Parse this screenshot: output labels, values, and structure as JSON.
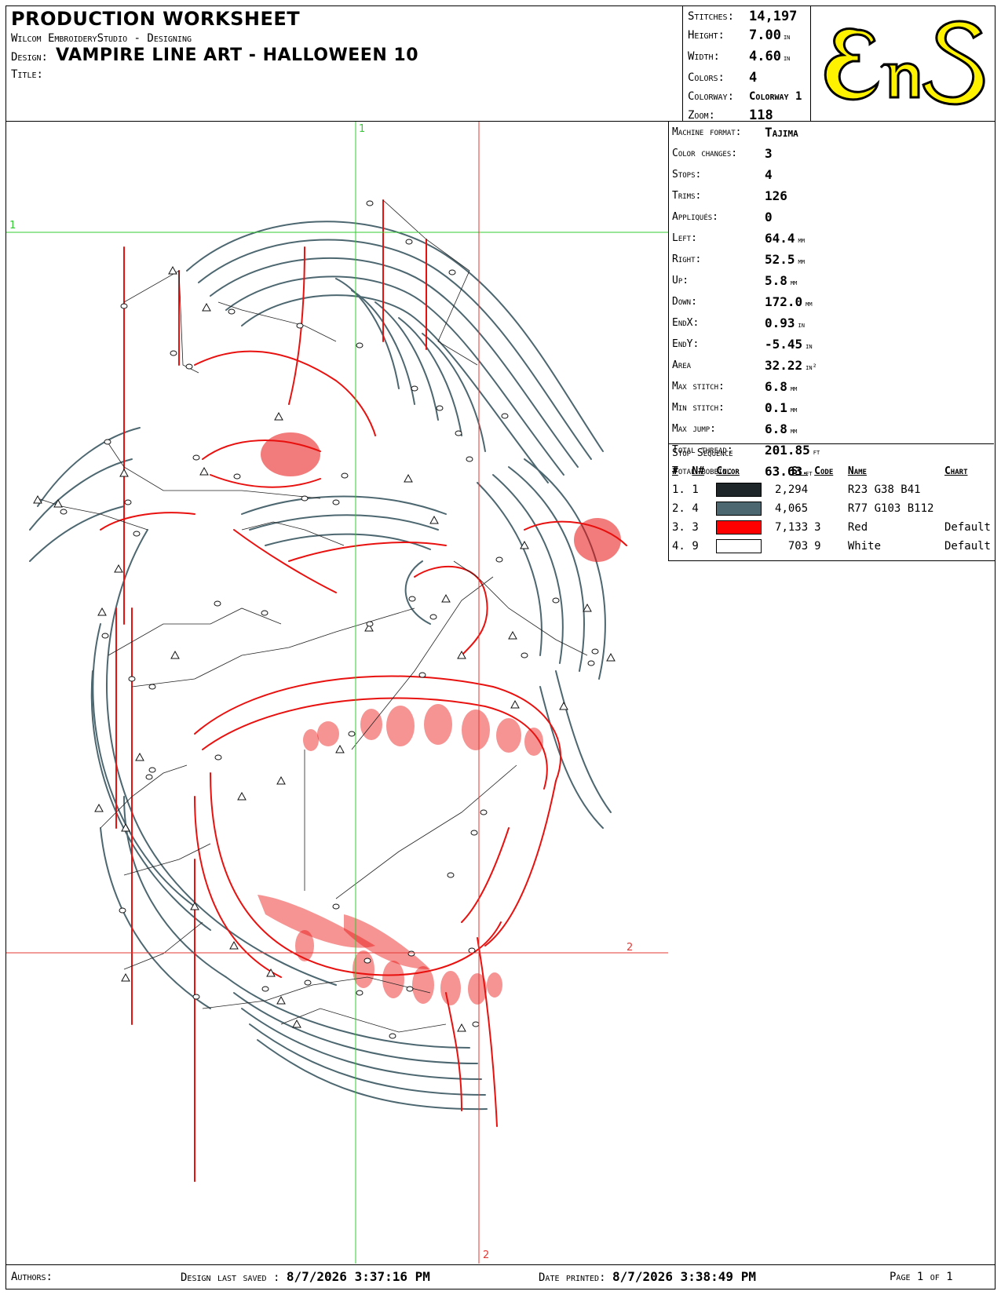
{
  "header": {
    "title": "PRODUCTION WORKSHEET",
    "software": "Wilcom EmbroideryStudio - Designing",
    "design_label": "Design:",
    "design_value": "VAMPIRE LINE ART - HALLOWEEN  10",
    "title_label": "Title:"
  },
  "summary": [
    {
      "label": "Stitches:",
      "value": "14,197",
      "unit": ""
    },
    {
      "label": "Height:",
      "value": "7.00",
      "unit": "in"
    },
    {
      "label": "Width:",
      "value": "4.60",
      "unit": "in"
    },
    {
      "label": "Colors:",
      "value": "4",
      "unit": ""
    },
    {
      "label": "Colorway:",
      "value": "Colorway 1",
      "unit": ""
    },
    {
      "label": "Zoom:",
      "value": "118",
      "unit": ""
    }
  ],
  "logo": {
    "text": "EnS",
    "fill_color": "#FFF200",
    "stroke_color": "#000000"
  },
  "stats": [
    {
      "label": "Machine format:",
      "value": "Tajima",
      "unit": ""
    },
    {
      "label": "Color changes:",
      "value": "3",
      "unit": ""
    },
    {
      "label": "Stops:",
      "value": "4",
      "unit": ""
    },
    {
      "label": "Trims:",
      "value": "126",
      "unit": ""
    },
    {
      "label": "Appliqués:",
      "value": "0",
      "unit": ""
    },
    {
      "label": "Left:",
      "value": "64.4",
      "unit": "mm"
    },
    {
      "label": "Right:",
      "value": "52.5",
      "unit": "mm"
    },
    {
      "label": "Up:",
      "value": "5.8",
      "unit": "mm"
    },
    {
      "label": "Down:",
      "value": "172.0",
      "unit": "mm"
    },
    {
      "label": "EndX:",
      "value": "0.93",
      "unit": "in"
    },
    {
      "label": "EndY:",
      "value": "-5.45",
      "unit": "in"
    },
    {
      "label": "Area",
      "value": "32.22",
      "unit": "in²"
    },
    {
      "label": "Max stitch:",
      "value": "6.8",
      "unit": "mm"
    },
    {
      "label": "Min stitch:",
      "value": "0.1",
      "unit": "mm"
    },
    {
      "label": "Max jump:",
      "value": "6.8",
      "unit": "mm"
    },
    {
      "label": "Total thread:",
      "value": "201.85",
      "unit": "ft"
    },
    {
      "label": "Total bobbin:",
      "value": "63.63",
      "unit": "ft"
    }
  ],
  "stop_sequence": {
    "caption": "Stop Sequence",
    "headers": [
      "#",
      "N#",
      "Color",
      "St.",
      "Code",
      "Name",
      "Chart"
    ],
    "rows": [
      {
        "n": "1.",
        "needle": "1",
        "color": "#1E2629",
        "stitches": "2,294",
        "code": "",
        "name": "R23 G38 B41",
        "chart": ""
      },
      {
        "n": "2.",
        "needle": "4",
        "color": "#4D6770",
        "stitches": "4,065",
        "code": "",
        "name": "R77 G103 B112",
        "chart": ""
      },
      {
        "n": "3.",
        "needle": "3",
        "color": "#FF0000",
        "stitches": "7,133",
        "code": "3",
        "name": "Red",
        "chart": "Default"
      },
      {
        "n": "4.",
        "needle": "9",
        "color": "#FFFFFF",
        "stitches": "703",
        "code": "9",
        "name": "White",
        "chart": "Default"
      }
    ]
  },
  "guides": {
    "v1_label": "1",
    "h1_label": "1",
    "v2_label": "2",
    "h2_label": "2",
    "green": "#33CC33",
    "red": "#E53935"
  },
  "artwork": {
    "thread_dark": "#4D6770",
    "thread_red": "#E8110F"
  },
  "footer": {
    "authors_label": "Authors:",
    "saved_label": "Design last saved :",
    "saved_value": "8/7/2026 3:37:16 PM",
    "printed_label": "Date printed:",
    "printed_value": "8/7/2026 3:38:49 PM",
    "page_text": "Page 1 of 1"
  }
}
